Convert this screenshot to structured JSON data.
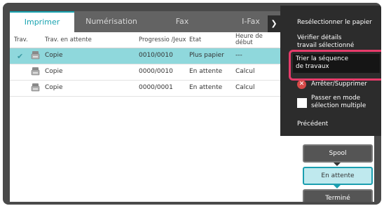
{
  "tabs": [
    {
      "label": "Imprimer",
      "active": true
    },
    {
      "label": "Numérisation",
      "active": false
    },
    {
      "label": "Fax",
      "active": false
    },
    {
      "label": "I-Fax",
      "active": false
    }
  ],
  "table": {
    "headers": {
      "trav": "Trav.",
      "waiting": "Trav. en attente",
      "progress": "Progressio /Jeux",
      "state": "Etat",
      "start_line1": "Heure de",
      "start_line2": "début"
    },
    "rows": [
      {
        "checked": true,
        "type_icon": "copy-icon",
        "name": "Copie",
        "progress": "0010/0010",
        "state": "Plus papier",
        "start": "---"
      },
      {
        "checked": false,
        "type_icon": "copy-icon",
        "name": "Copie",
        "progress": "0000/0010",
        "state": "En attente",
        "start": "Calcul"
      },
      {
        "checked": false,
        "type_icon": "copy-icon",
        "name": "Copie",
        "progress": "0000/0001",
        "state": "En attente",
        "start": "Calcul"
      }
    ]
  },
  "side_buttons": {
    "spool": "Spool",
    "waiting": "En attente",
    "done": "Terminé"
  },
  "action_menu": {
    "reselect_paper": "Resélectionner le papier",
    "check_details_line1": "Vérifier détails",
    "check_details_line2": "travail sélectionné",
    "sort_sequence_line1": "Trier la séquence",
    "sort_sequence_line2": "de travaux",
    "stop_delete": "Arrêter/Supprimer",
    "multi_select_line1": "Passer en mode",
    "multi_select_line2": "sélection multiple",
    "previous": "Précédent"
  },
  "colors": {
    "accent": "#18a3b0",
    "highlight": "#e63b6a",
    "selected_row": "#8fd8dc"
  }
}
